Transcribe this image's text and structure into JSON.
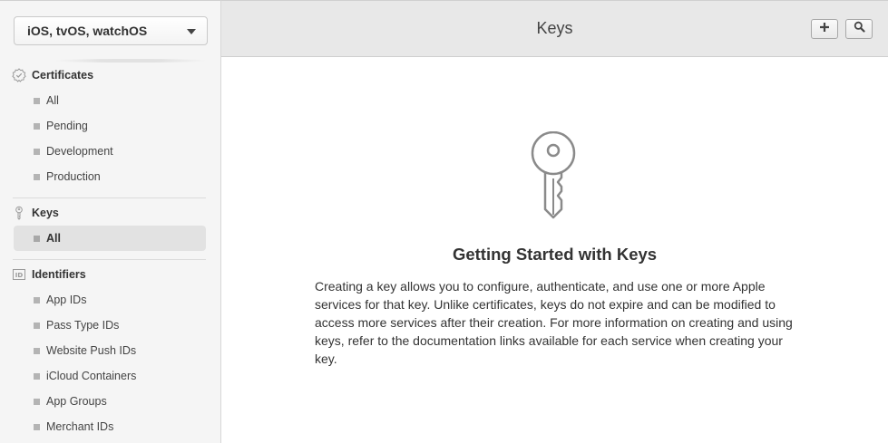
{
  "sidebar": {
    "platform_select": {
      "value": "iOS, tvOS, watchOS"
    },
    "sections": {
      "certificates": {
        "title": "Certificates",
        "icon": "certificate-badge-icon",
        "items": [
          "All",
          "Pending",
          "Development",
          "Production"
        ]
      },
      "keys": {
        "title": "Keys",
        "icon": "key-icon",
        "items": [
          "All"
        ],
        "active_item": "All"
      },
      "identifiers": {
        "title": "Identifiers",
        "icon": "id-icon",
        "items": [
          "App IDs",
          "Pass Type IDs",
          "Website Push IDs",
          "iCloud Containers",
          "App Groups",
          "Merchant IDs"
        ]
      }
    }
  },
  "header": {
    "title": "Keys",
    "buttons": [
      {
        "name": "add-button",
        "icon": "plus-icon"
      },
      {
        "name": "search-button",
        "icon": "search-icon"
      }
    ]
  },
  "main": {
    "illustration": "key-icon",
    "empty_state": {
      "title": "Getting Started with Keys",
      "body": "Creating a key allows you to configure, authenticate, and use one or more Apple services for that key. Unlike certificates, keys do not expire and can be modified to access more services after their creation. For more information on creating and using keys, refer to the documentation links available for each service when creating your key."
    }
  },
  "colors": {
    "sidebar_bg": "#f5f5f5",
    "header_bg": "#e8e8e8",
    "active_item_bg": "#e2e2e2",
    "bullet": "#b4b4b4"
  }
}
